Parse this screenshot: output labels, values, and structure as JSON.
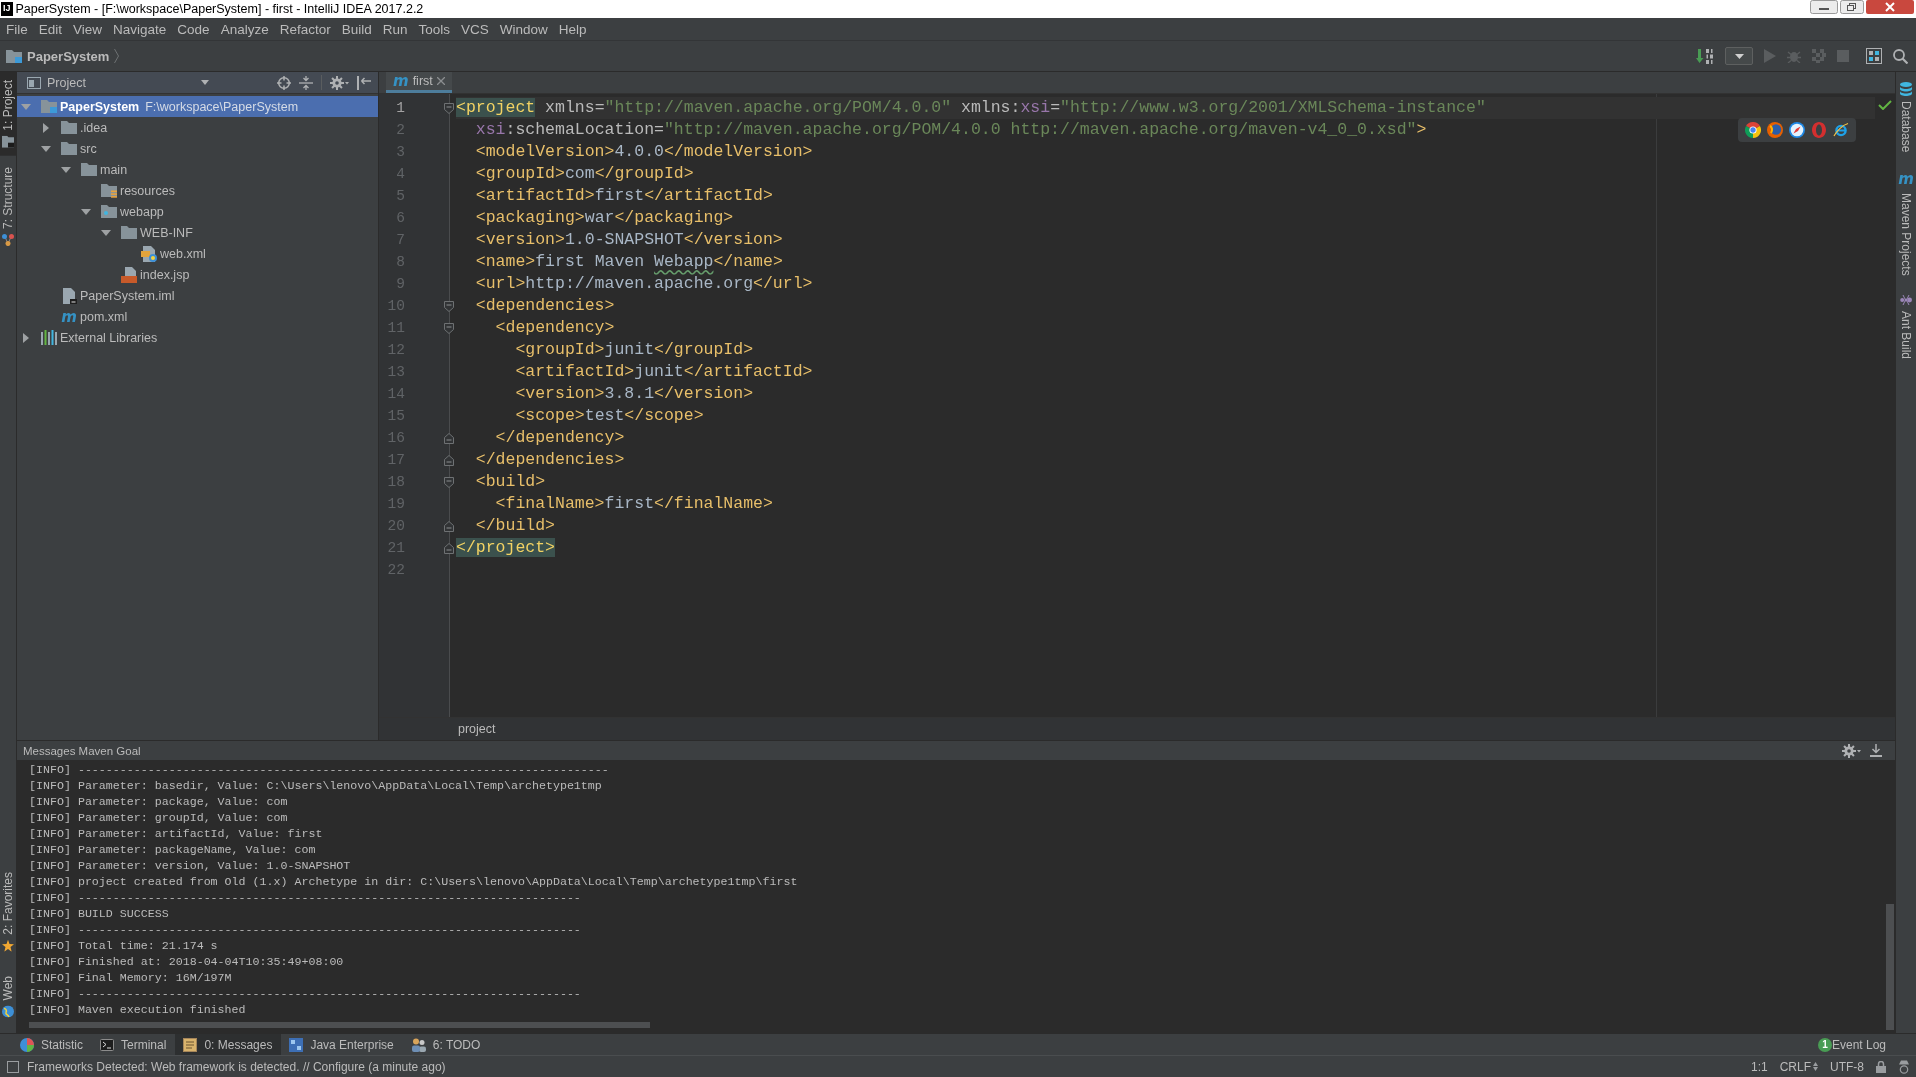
{
  "window": {
    "logo": "IJ",
    "title": "PaperSystem - [F:\\workspace\\PaperSystem] - first - IntelliJ IDEA 2017.2.2"
  },
  "menu": [
    "File",
    "Edit",
    "View",
    "Navigate",
    "Code",
    "Analyze",
    "Refactor",
    "Build",
    "Run",
    "Tools",
    "VCS",
    "Window",
    "Help"
  ],
  "navigation_bar": {
    "breadcrumb": "PaperSystem"
  },
  "toolbar": [
    {
      "kind": "build",
      "disabled": false
    },
    {
      "kind": "run_configurations",
      "disabled": false
    },
    {
      "kind": "run",
      "disabled": true
    },
    {
      "kind": "debug",
      "disabled": true
    },
    {
      "kind": "coverage",
      "disabled": true
    },
    {
      "kind": "stop",
      "disabled": true
    },
    {
      "kind": "project_structure",
      "disabled": false
    },
    {
      "kind": "search",
      "disabled": false
    }
  ],
  "left_stripe": {
    "top": [
      {
        "label": "1: Project",
        "kind": "project",
        "selected": true
      },
      {
        "label": "7: Structure",
        "kind": "structure",
        "selected": false
      }
    ],
    "bottom": [
      {
        "label": "2: Favorites",
        "kind": "favorites",
        "selected": false
      },
      {
        "label": "Web",
        "kind": "web",
        "selected": false
      }
    ]
  },
  "project_panel": {
    "title": "Project",
    "tree": [
      {
        "label": "PaperSystem",
        "path": "F:\\workspace\\PaperSystem",
        "kind": "module",
        "expanded": true,
        "selected": true,
        "children": [
          {
            "label": ".idea",
            "kind": "folder",
            "expanded": false,
            "selected": false
          },
          {
            "label": "src",
            "kind": "folder",
            "expanded": true,
            "selected": false,
            "children": [
              {
                "label": "main",
                "kind": "folder",
                "expanded": true,
                "selected": false,
                "children": [
                  {
                    "label": "resources",
                    "kind": "resources",
                    "selected": false
                  },
                  {
                    "label": "webapp",
                    "kind": "web",
                    "expanded": true,
                    "selected": false,
                    "children": [
                      {
                        "label": "WEB-INF",
                        "kind": "folder",
                        "expanded": true,
                        "selected": false,
                        "children": [
                          {
                            "label": "web.xml",
                            "kind": "web_xml",
                            "selected": false
                          }
                        ]
                      },
                      {
                        "label": "index.jsp",
                        "kind": "jsp",
                        "selected": false
                      }
                    ]
                  }
                ]
              }
            ]
          },
          {
            "label": "PaperSystem.iml",
            "kind": "iml",
            "selected": false
          },
          {
            "label": "pom.xml",
            "kind": "maven",
            "glyph": "m",
            "selected": false
          }
        ]
      },
      {
        "label": "External Libraries",
        "kind": "libraries",
        "expanded": false,
        "selected": false
      }
    ]
  },
  "editor": {
    "tabs": [
      {
        "label": "first",
        "glyph": "m",
        "selected": true
      }
    ],
    "lines": [
      {
        "number": "1",
        "current": true,
        "kind": "fold_start",
        "tokens": [
          {
            "kind": "match",
            "text": "<project"
          },
          {
            "kind": "attr",
            "text": " xmlns="
          },
          {
            "kind": "value",
            "text": "\"http://maven.apache.org/POM/4.0.0\""
          },
          {
            "kind": "attr",
            "text": " xmlns:"
          },
          {
            "kind": "ns",
            "text": "xsi"
          },
          {
            "kind": "attr",
            "text": "="
          },
          {
            "kind": "value",
            "text": "\"http://www.w3.org/2001/XMLSchema-instance\""
          }
        ]
      },
      {
        "number": "2",
        "current": false,
        "kind": "plain",
        "tokens": [
          {
            "kind": "ns",
            "text": "  xsi"
          },
          {
            "kind": "attr",
            "text": ":schemaLocation="
          },
          {
            "kind": "value",
            "text": "\"http://maven.apache.org/POM/4.0.0 http://maven.apache.org/maven-v4_0_0.xsd\""
          },
          {
            "kind": "tag",
            "text": ">"
          }
        ]
      },
      {
        "number": "3",
        "current": false,
        "kind": "plain",
        "tokens": [
          {
            "kind": "tag",
            "text": "  <modelVersion>"
          },
          {
            "kind": "text",
            "text": "4.0.0"
          },
          {
            "kind": "tag",
            "text": "</modelVersion>"
          }
        ]
      },
      {
        "number": "4",
        "current": false,
        "kind": "plain",
        "tokens": [
          {
            "kind": "tag",
            "text": "  <groupId>"
          },
          {
            "kind": "text",
            "text": "com"
          },
          {
            "kind": "tag",
            "text": "</groupId>"
          }
        ]
      },
      {
        "number": "5",
        "current": false,
        "kind": "plain",
        "tokens": [
          {
            "kind": "tag",
            "text": "  <artifactId>"
          },
          {
            "kind": "text",
            "text": "first"
          },
          {
            "kind": "tag",
            "text": "</artifactId>"
          }
        ]
      },
      {
        "number": "6",
        "current": false,
        "kind": "plain",
        "tokens": [
          {
            "kind": "tag",
            "text": "  <packaging>"
          },
          {
            "kind": "text",
            "text": "war"
          },
          {
            "kind": "tag",
            "text": "</packaging>"
          }
        ]
      },
      {
        "number": "7",
        "current": false,
        "kind": "plain",
        "tokens": [
          {
            "kind": "tag",
            "text": "  <version>"
          },
          {
            "kind": "text",
            "text": "1.0-SNAPSHOT"
          },
          {
            "kind": "tag",
            "text": "</version>"
          }
        ]
      },
      {
        "number": "8",
        "current": false,
        "kind": "plain",
        "tokens": [
          {
            "kind": "tag",
            "text": "  <name>"
          },
          {
            "kind": "text",
            "text": "first Maven "
          },
          {
            "kind": "typo",
            "text": "Webapp"
          },
          {
            "kind": "tag",
            "text": "</name>"
          }
        ]
      },
      {
        "number": "9",
        "current": false,
        "kind": "plain",
        "tokens": [
          {
            "kind": "tag",
            "text": "  <url>"
          },
          {
            "kind": "text",
            "text": "http://maven.apache.org"
          },
          {
            "kind": "tag",
            "text": "</url>"
          }
        ]
      },
      {
        "number": "10",
        "current": false,
        "kind": "fold_start",
        "tokens": [
          {
            "kind": "tag",
            "text": "  <dependencies>"
          }
        ]
      },
      {
        "number": "11",
        "current": false,
        "kind": "fold_start",
        "tokens": [
          {
            "kind": "tag",
            "text": "    <dependency>"
          }
        ]
      },
      {
        "number": "12",
        "current": false,
        "kind": "plain",
        "tokens": [
          {
            "kind": "tag",
            "text": "      <groupId>"
          },
          {
            "kind": "text",
            "text": "junit"
          },
          {
            "kind": "tag",
            "text": "</groupId>"
          }
        ]
      },
      {
        "number": "13",
        "current": false,
        "kind": "plain",
        "tokens": [
          {
            "kind": "tag",
            "text": "      <artifactId>"
          },
          {
            "kind": "text",
            "text": "junit"
          },
          {
            "kind": "tag",
            "text": "</artifactId>"
          }
        ]
      },
      {
        "number": "14",
        "current": false,
        "kind": "plain",
        "tokens": [
          {
            "kind": "tag",
            "text": "      <version>"
          },
          {
            "kind": "text",
            "text": "3.8.1"
          },
          {
            "kind": "tag",
            "text": "</version>"
          }
        ]
      },
      {
        "number": "15",
        "current": false,
        "kind": "plain",
        "tokens": [
          {
            "kind": "tag",
            "text": "      <scope>"
          },
          {
            "kind": "text",
            "text": "test"
          },
          {
            "kind": "tag",
            "text": "</scope>"
          }
        ]
      },
      {
        "number": "16",
        "current": false,
        "kind": "fold_end",
        "tokens": [
          {
            "kind": "tag",
            "text": "    </dependency>"
          }
        ]
      },
      {
        "number": "17",
        "current": false,
        "kind": "fold_end",
        "tokens": [
          {
            "kind": "tag",
            "text": "  </dependencies>"
          }
        ]
      },
      {
        "number": "18",
        "current": false,
        "kind": "fold_start",
        "tokens": [
          {
            "kind": "tag",
            "text": "  <build>"
          }
        ]
      },
      {
        "number": "19",
        "current": false,
        "kind": "plain",
        "tokens": [
          {
            "kind": "tag",
            "text": "    <finalName>"
          },
          {
            "kind": "text",
            "text": "first"
          },
          {
            "kind": "tag",
            "text": "</finalName>"
          }
        ]
      },
      {
        "number": "20",
        "current": false,
        "kind": "fold_end",
        "tokens": [
          {
            "kind": "tag",
            "text": "  </build>"
          }
        ]
      },
      {
        "number": "21",
        "current": false,
        "kind": "fold_end",
        "tokens": [
          {
            "kind": "match",
            "text": "</project>"
          }
        ]
      },
      {
        "number": "22",
        "current": false,
        "kind": "plain"
      }
    ],
    "breadcrumb": "project"
  },
  "right_stripe": [
    {
      "label": "Database",
      "kind": "database"
    },
    {
      "label": "Maven Projects",
      "kind": "maven",
      "glyph": "m"
    },
    {
      "label": "Ant Build",
      "kind": "ant"
    }
  ],
  "messages": {
    "title": "Messages Maven Goal",
    "lines": [
      "[INFO] ----------------------------------------------------------------------------",
      "[INFO] Parameter: basedir, Value: C:\\Users\\lenovo\\AppData\\Local\\Temp\\archetype1tmp",
      "[INFO] Parameter: package, Value: com",
      "[INFO] Parameter: groupId, Value: com",
      "[INFO] Parameter: artifactId, Value: first",
      "[INFO] Parameter: packageName, Value: com",
      "[INFO] Parameter: version, Value: 1.0-SNAPSHOT",
      "[INFO] project created from Old (1.x) Archetype in dir: C:\\Users\\lenovo\\AppData\\Local\\Temp\\archetype1tmp\\first",
      "[INFO] ------------------------------------------------------------------------",
      "[INFO] BUILD SUCCESS",
      "[INFO] ------------------------------------------------------------------------",
      "[INFO] Total time: 21.174 s",
      "[INFO] Finished at: 2018-04-04T10:35:49+08:00",
      "[INFO] Final Memory: 16M/197M",
      "[INFO] ------------------------------------------------------------------------",
      "[INFO] Maven execution finished"
    ]
  },
  "tool_windows": [
    {
      "label": "Statistic",
      "kind": "statistic",
      "selected": false
    },
    {
      "label": "Terminal",
      "kind": "terminal",
      "selected": false
    },
    {
      "label": "0: Messages",
      "kind": "messages",
      "selected": true
    },
    {
      "label": "Java Enterprise",
      "kind": "java_enterprise",
      "selected": false
    },
    {
      "label": "6: TODO",
      "kind": "todo",
      "selected": false
    }
  ],
  "event_log": {
    "badge": "1",
    "label": "Event Log"
  },
  "status_bar": {
    "message": "Frameworks Detected: Web framework is detected. // Configure (a minute ago)",
    "caret": "1:1",
    "line_separator": "CRLF",
    "encoding": "UTF-8"
  }
}
